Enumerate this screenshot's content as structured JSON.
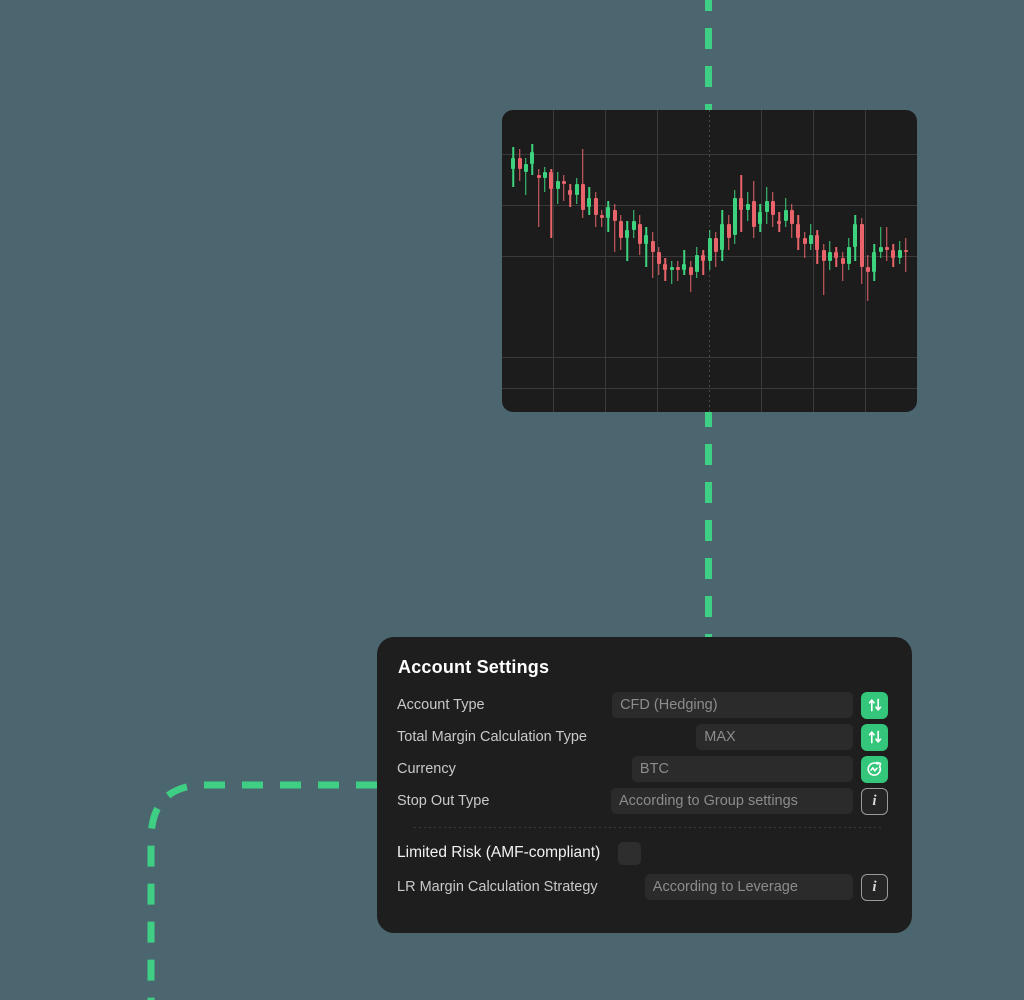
{
  "theme": {
    "page_background": "#4C6670",
    "panel_background": "#1E1E1E",
    "field_background": "#2B2B2B",
    "accent_green": "#34C77B",
    "connector_green": "#3ECF84",
    "label_color": "#C9C9C9",
    "placeholder_color": "#8C8C8C",
    "chart_background": "#1C1C1C",
    "candle_up_color": "#3DD37E",
    "candle_down_color": "#E8646A"
  },
  "panel": {
    "title": "Account Settings",
    "rows": [
      {
        "label": "Account Type",
        "value": "CFD (Hedging)",
        "action_icon": "up-down-arrows-icon",
        "action_style": "green"
      },
      {
        "label": "Total Margin Calculation Type",
        "value": "MAX",
        "action_icon": "up-down-arrows-icon",
        "action_style": "green"
      },
      {
        "label": "Currency",
        "value": "BTC",
        "action_icon": "refresh-wave-icon",
        "action_style": "green"
      },
      {
        "label": "Stop Out Type",
        "value": "According to Group settings",
        "action_icon": "info-icon",
        "action_style": "outline",
        "action_label": "i"
      }
    ],
    "limited_risk": {
      "label": "Limited Risk (AMF-compliant)",
      "checked": false
    },
    "lr_margin": {
      "label": "LR Margin Calculation Strategy",
      "value": "According to Leverage",
      "action_icon": "info-icon",
      "action_style": "outline",
      "action_label": "i"
    }
  },
  "chart_data": {
    "type": "candlestick",
    "title": "",
    "xlabel": "",
    "ylabel": "",
    "grid": true,
    "legend_position": "none",
    "ylim": [
      0,
      100
    ],
    "candles": [
      {
        "o": 82,
        "c": 86,
        "h": 90,
        "l": 76
      },
      {
        "o": 86,
        "c": 82,
        "h": 89,
        "l": 78
      },
      {
        "o": 81,
        "c": 84,
        "h": 86,
        "l": 73
      },
      {
        "o": 84,
        "c": 88,
        "h": 91,
        "l": 80
      },
      {
        "o": 80,
        "c": 79,
        "h": 82,
        "l": 62
      },
      {
        "o": 79,
        "c": 81,
        "h": 83,
        "l": 74
      },
      {
        "o": 81,
        "c": 75,
        "h": 82,
        "l": 58
      },
      {
        "o": 75,
        "c": 78,
        "h": 81,
        "l": 70
      },
      {
        "o": 78,
        "c": 77,
        "h": 80,
        "l": 71
      },
      {
        "o": 75,
        "c": 73,
        "h": 77,
        "l": 69
      },
      {
        "o": 73,
        "c": 77,
        "h": 79,
        "l": 70
      },
      {
        "o": 77,
        "c": 68,
        "h": 89,
        "l": 65
      },
      {
        "o": 69,
        "c": 72,
        "h": 76,
        "l": 66
      },
      {
        "o": 72,
        "c": 66,
        "h": 74,
        "l": 62
      },
      {
        "o": 66,
        "c": 65,
        "h": 68,
        "l": 62
      },
      {
        "o": 65,
        "c": 69,
        "h": 71,
        "l": 60
      },
      {
        "o": 68,
        "c": 64,
        "h": 70,
        "l": 53
      },
      {
        "o": 64,
        "c": 58,
        "h": 66,
        "l": 54
      },
      {
        "o": 58,
        "c": 61,
        "h": 64,
        "l": 50
      },
      {
        "o": 61,
        "c": 64,
        "h": 68,
        "l": 58
      },
      {
        "o": 63,
        "c": 56,
        "h": 66,
        "l": 52
      },
      {
        "o": 56,
        "c": 59,
        "h": 62,
        "l": 48
      },
      {
        "o": 57,
        "c": 53,
        "h": 60,
        "l": 44
      },
      {
        "o": 53,
        "c": 49,
        "h": 55,
        "l": 45
      },
      {
        "o": 49,
        "c": 47,
        "h": 51,
        "l": 43
      },
      {
        "o": 47,
        "c": 48,
        "h": 50,
        "l": 42
      },
      {
        "o": 48,
        "c": 47,
        "h": 50,
        "l": 43
      },
      {
        "o": 47,
        "c": 49,
        "h": 54,
        "l": 45
      },
      {
        "o": 48,
        "c": 45,
        "h": 50,
        "l": 39
      },
      {
        "o": 46,
        "c": 52,
        "h": 55,
        "l": 44
      },
      {
        "o": 52,
        "c": 50,
        "h": 54,
        "l": 45
      },
      {
        "o": 50,
        "c": 58,
        "h": 61,
        "l": 47
      },
      {
        "o": 58,
        "c": 53,
        "h": 60,
        "l": 48
      },
      {
        "o": 54,
        "c": 63,
        "h": 68,
        "l": 50
      },
      {
        "o": 63,
        "c": 58,
        "h": 66,
        "l": 54
      },
      {
        "o": 59,
        "c": 72,
        "h": 75,
        "l": 56
      },
      {
        "o": 72,
        "c": 68,
        "h": 80,
        "l": 60
      },
      {
        "o": 68,
        "c": 70,
        "h": 74,
        "l": 64
      },
      {
        "o": 71,
        "c": 62,
        "h": 78,
        "l": 58
      },
      {
        "o": 63,
        "c": 67,
        "h": 70,
        "l": 60
      },
      {
        "o": 67,
        "c": 71,
        "h": 76,
        "l": 63
      },
      {
        "o": 71,
        "c": 66,
        "h": 74,
        "l": 62
      },
      {
        "o": 64,
        "c": 63,
        "h": 67,
        "l": 60
      },
      {
        "o": 64,
        "c": 68,
        "h": 72,
        "l": 62
      },
      {
        "o": 68,
        "c": 63,
        "h": 70,
        "l": 58
      },
      {
        "o": 63,
        "c": 58,
        "h": 66,
        "l": 54
      },
      {
        "o": 58,
        "c": 56,
        "h": 60,
        "l": 51
      },
      {
        "o": 56,
        "c": 59,
        "h": 63,
        "l": 54
      },
      {
        "o": 59,
        "c": 54,
        "h": 61,
        "l": 49
      },
      {
        "o": 54,
        "c": 50,
        "h": 56,
        "l": 38
      },
      {
        "o": 50,
        "c": 53,
        "h": 57,
        "l": 47
      },
      {
        "o": 53,
        "c": 51,
        "h": 55,
        "l": 48
      },
      {
        "o": 51,
        "c": 49,
        "h": 53,
        "l": 43
      },
      {
        "o": 49,
        "c": 55,
        "h": 58,
        "l": 47
      },
      {
        "o": 55,
        "c": 63,
        "h": 66,
        "l": 50
      },
      {
        "o": 63,
        "c": 48,
        "h": 65,
        "l": 42
      },
      {
        "o": 48,
        "c": 46,
        "h": 52,
        "l": 36
      },
      {
        "o": 46,
        "c": 53,
        "h": 56,
        "l": 43
      },
      {
        "o": 53,
        "c": 55,
        "h": 62,
        "l": 51
      },
      {
        "o": 55,
        "c": 54,
        "h": 62,
        "l": 50
      },
      {
        "o": 54,
        "c": 51,
        "h": 56,
        "l": 48
      },
      {
        "o": 51,
        "c": 54,
        "h": 57,
        "l": 49
      },
      {
        "o": 54,
        "c": 53,
        "h": 58,
        "l": 46
      }
    ]
  },
  "connectors": [
    {
      "name": "vertical-dashed-connector-top",
      "orientation": "vertical",
      "color": "#3ECF84"
    },
    {
      "name": "elbow-dashed-connector-bottom-left",
      "orientation": "elbow",
      "color": "#3ECF84"
    }
  ]
}
